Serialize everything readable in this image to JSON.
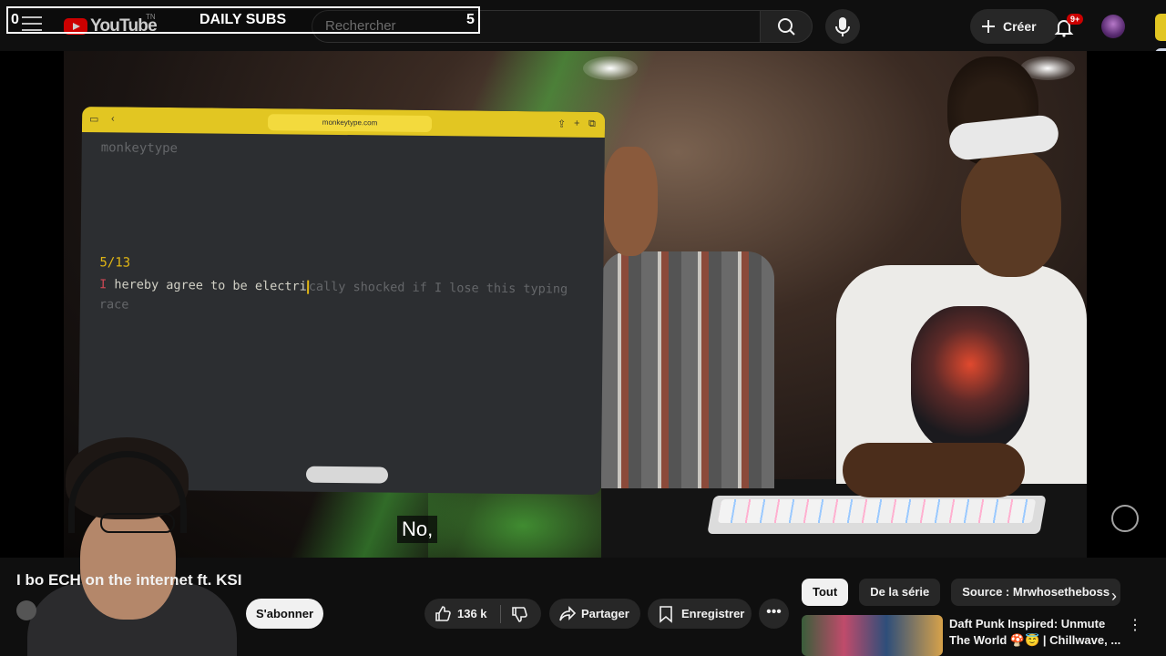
{
  "overlay": {
    "left_count": "0",
    "title": "DAILY SUBS",
    "right_count": "5"
  },
  "header": {
    "logo_text": "YouTube",
    "logo_suffix": "TN",
    "search_placeholder": "Rechercher",
    "create_label": "Créer",
    "notification_badge": "9+"
  },
  "video": {
    "monkeytype": {
      "url": "monkeytype.com",
      "brand": "monkeytype",
      "progress": "5/13",
      "wrong_char": "I",
      "typed": " hereby agree to be electri",
      "untyped": "cally shocked if I lose this typing race"
    },
    "caption": "No,"
  },
  "below": {
    "title": "I bo                                          ECH on the internet ft. KSI",
    "subscribe_label": "S'abonner",
    "like_count": "136 k",
    "share_label": "Partager",
    "save_label": "Enregistrer",
    "more_label": "•••"
  },
  "chips": [
    "Tout",
    "De la série",
    "Source : Mrwhosetheboss"
  ],
  "recommendation": {
    "title": "Daft Punk Inspired: Unmute The World 🍄😇 | Chillwave, ..."
  },
  "colors": {
    "brand_red": "#ff0000",
    "monkeytype_yellow": "#e2c622",
    "monkeytype_bg": "#2c2e31",
    "monkeytype_accent": "#e2b714",
    "monkeytype_error": "#ca4754"
  }
}
